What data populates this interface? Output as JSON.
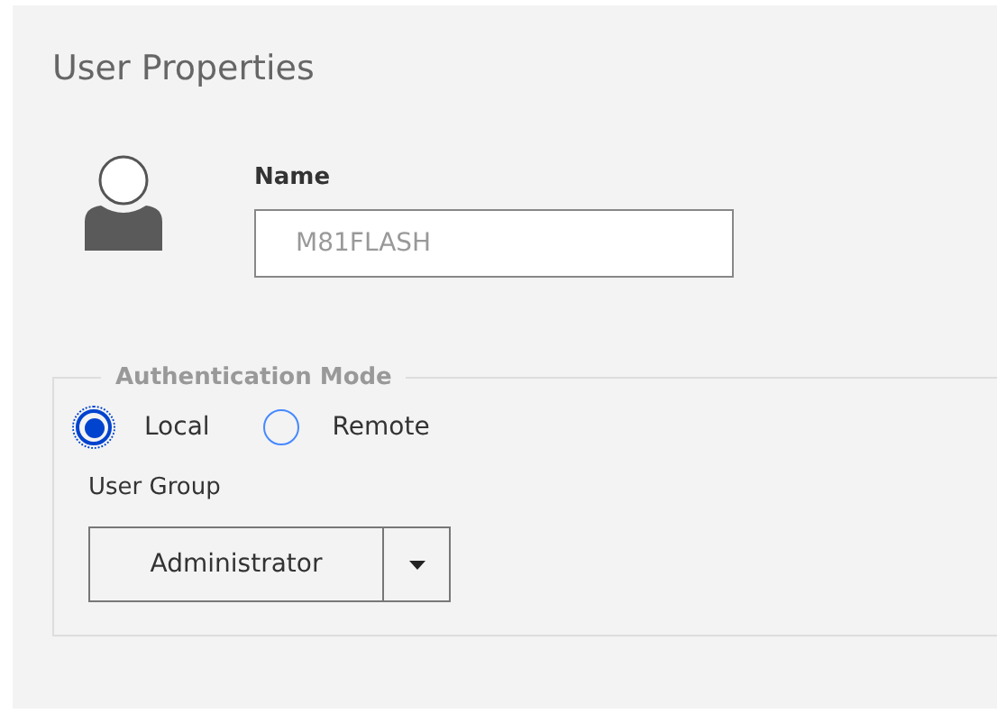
{
  "panel": {
    "title": "User Properties"
  },
  "name_field": {
    "label": "Name",
    "value": "M81FLASH",
    "disabled": true
  },
  "authentication": {
    "legend": "Authentication Mode",
    "options": [
      {
        "label": "Local",
        "selected": true
      },
      {
        "label": "Remote",
        "selected": false
      }
    ]
  },
  "user_group": {
    "label": "User Group",
    "value": "Administrator"
  }
}
